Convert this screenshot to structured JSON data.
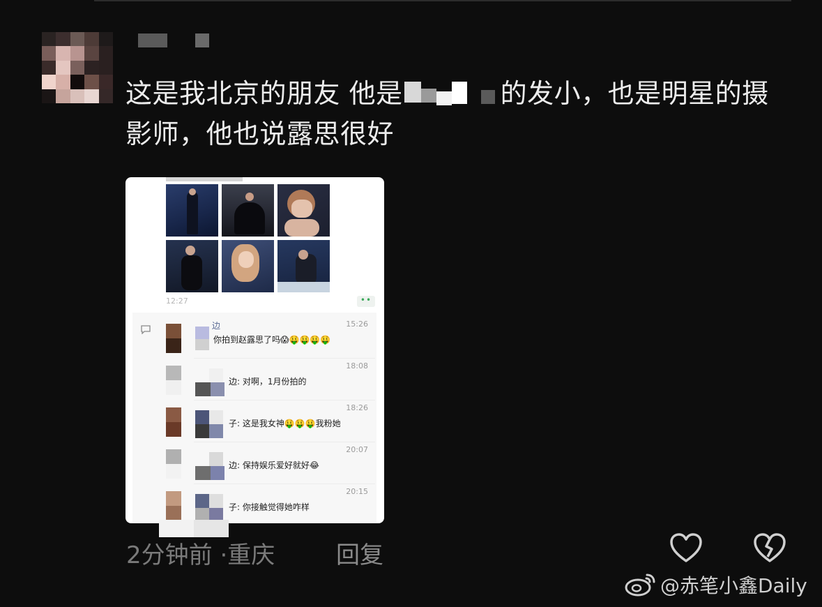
{
  "comment": {
    "text_part1": "这是我北京的朋友 他是",
    "text_part2": "的发小，也是明星的摄影师，他也说露思很好"
  },
  "embedded_chat": {
    "photo_timestamp": "12:27",
    "more_label": "••",
    "comments": [
      {
        "name_suffix": "边",
        "text": "你拍到赵露思了吗😱🤑🤑🤑🤑",
        "time": "15:26"
      },
      {
        "name_suffix": "",
        "text": "边: 对啊，1月份拍的",
        "time": "18:08"
      },
      {
        "name_suffix": "",
        "text": "子: 这是我女神🤑🤑🤑我粉她",
        "time": "18:26"
      },
      {
        "name_suffix": "",
        "text": "边: 保持娱乐爱好就好😂",
        "time": "20:07"
      },
      {
        "name_suffix": "",
        "text": "子: 你接触觉得她咋样",
        "time": "20:15"
      }
    ]
  },
  "footer": {
    "time_ago": "2分钟前",
    "location_sep": "·",
    "location": "重庆",
    "reply_label": "回复",
    "like_icon": "heart-outline-icon",
    "dislike_icon": "broken-heart-icon"
  },
  "watermark": {
    "text": "@赤笔小鑫Daily"
  }
}
